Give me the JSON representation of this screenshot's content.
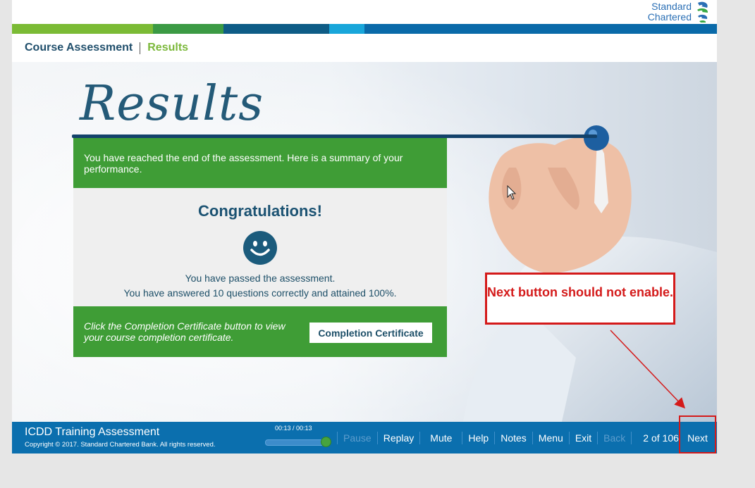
{
  "header": {
    "logo_line1": "Standard",
    "logo_line2": "Chartered",
    "brand_colors": [
      "#7bbb35",
      "#3b9a44",
      "#0e5c86",
      "#18a6da",
      "#0a6aa9"
    ]
  },
  "breadcrumb": {
    "course": "Course Assessment",
    "current": "Results"
  },
  "stage": {
    "title": "Results",
    "intro": "You have reached the end of the assessment. Here is a summary of your performance.",
    "congrats": "Congratulations!",
    "pass_text": "You have passed the assessment.",
    "score_text": "You have answered 10 questions correctly and attained 100%.",
    "cert_instructions": "Click the Completion Certificate button to view your course completion certificate.",
    "cert_button": "Completion Certificate"
  },
  "annotation": {
    "text": "Next button should not enable."
  },
  "footer": {
    "course_title": "ICDD Training Assessment",
    "copyright": "Copyright © 2017. Standard Chartered Bank. All rights reserved.",
    "timecode": "00:13 / 00:13",
    "progress": 1.0,
    "controls": {
      "pause": "Pause",
      "replay": "Replay",
      "mute": "Mute",
      "help": "Help",
      "notes": "Notes",
      "menu": "Menu",
      "exit": "Exit",
      "back": "Back",
      "page": "2 of 106",
      "next": "Next"
    }
  },
  "colors": {
    "accent_green": "#3f9d36",
    "footer_blue": "#0b6fae",
    "annotation_red": "#d41a1a",
    "title_blue": "#1b5272"
  }
}
